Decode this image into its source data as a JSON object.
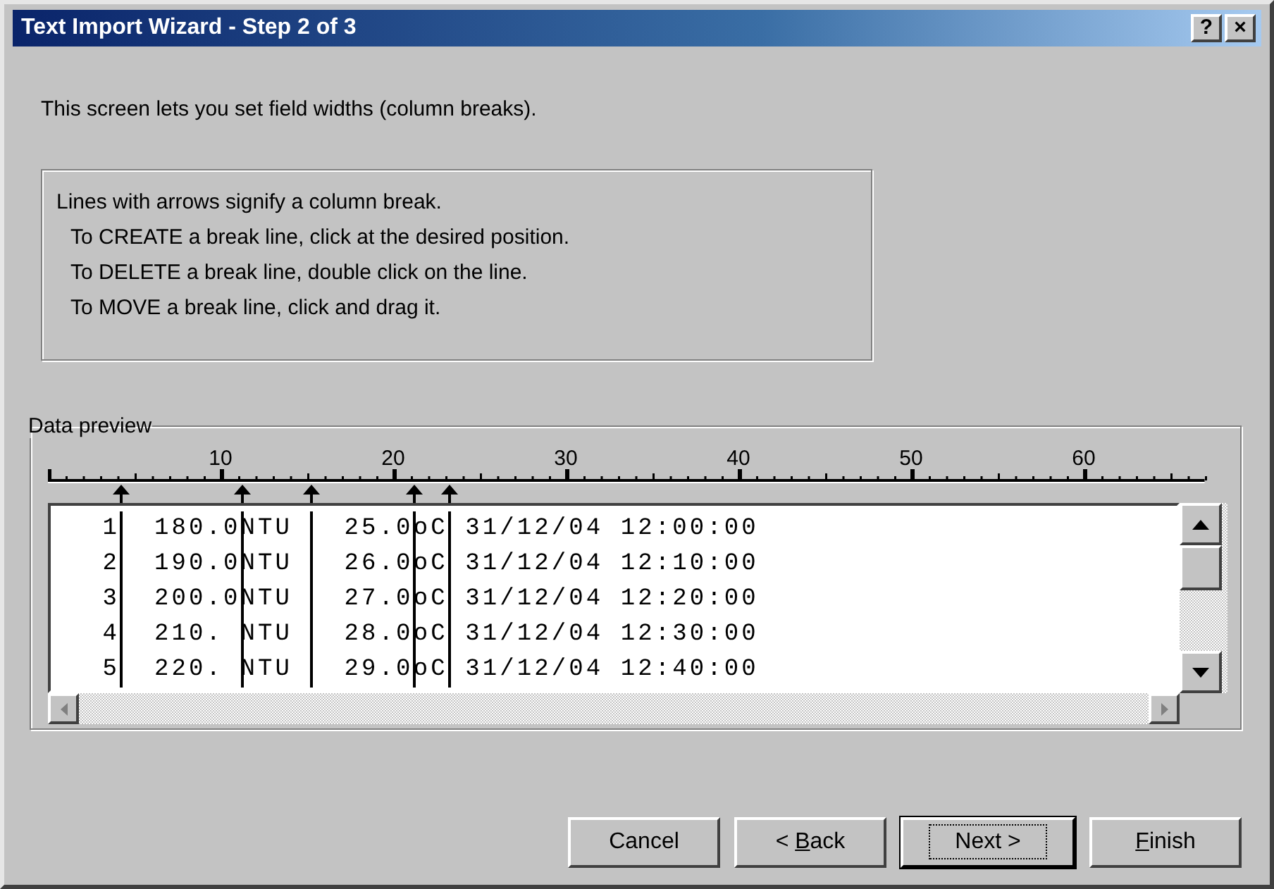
{
  "window": {
    "title": "Text Import Wizard - Step 2 of 3",
    "help_button": "?",
    "close_button": "×"
  },
  "intro": "This screen lets you set field widths (column breaks).",
  "instructions": {
    "heading": "Lines with arrows signify a column break.",
    "lines": [
      "To CREATE a break line, click at the desired position.",
      "To DELETE a break line, double click on the line.",
      "To MOVE a break line, click and drag it."
    ]
  },
  "data_preview": {
    "label": "Data preview",
    "ruler_labels": [
      "10",
      "20",
      "30",
      "40",
      "50",
      "60"
    ],
    "rows": [
      [
        "   1",
        "  180.0",
        "NTU ",
        "  25.0",
        "oC",
        " 31/12/04 12:00:00"
      ],
      [
        "   2",
        "  190.0",
        "NTU ",
        "  26.0",
        "oC",
        " 31/12/04 12:10:00"
      ],
      [
        "   3",
        "  200.0",
        "NTU ",
        "  27.0",
        "oC",
        " 31/12/04 12:20:00"
      ],
      [
        "   4",
        "  210. ",
        "NTU ",
        "  28.0",
        "oC",
        " 31/12/04 12:30:00"
      ],
      [
        "   5",
        "  220. ",
        "NTU ",
        "  29.0",
        "oC",
        " 31/12/04 12:40:00"
      ]
    ]
  },
  "buttons": [
    {
      "before": "Cancel",
      "default": false
    },
    {
      "before": "< ",
      "key": "B",
      "after": "ack",
      "default": false
    },
    {
      "before": "Next >",
      "default": true
    },
    {
      "key": "F",
      "after": "inish",
      "default": false
    }
  ]
}
